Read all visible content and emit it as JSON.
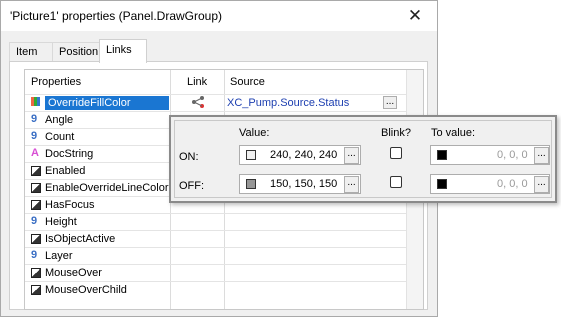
{
  "window": {
    "title": "'Picture1' properties (Panel.DrawGroup)",
    "close_glyph": "✕"
  },
  "tabs": [
    {
      "label": "Item"
    },
    {
      "label": "Position"
    },
    {
      "label": "Links"
    }
  ],
  "grid": {
    "headers": {
      "properties": "Properties",
      "link": "Link",
      "source": "Source"
    },
    "rows": [
      {
        "name": "OverrideFillColor",
        "type": "color",
        "icon": "color-type-icon",
        "linked": true,
        "source": "XC_Pump.Source.Status",
        "selected": true
      },
      {
        "name": "Angle",
        "type": "num",
        "icon_glyph": "9"
      },
      {
        "name": "Count",
        "type": "num",
        "icon_glyph": "9"
      },
      {
        "name": "DocString",
        "type": "str",
        "icon_glyph": "A"
      },
      {
        "name": "Enabled",
        "type": "bool"
      },
      {
        "name": "EnableOverrideLineColor",
        "type": "bool"
      },
      {
        "name": "HasFocus",
        "type": "bool"
      },
      {
        "name": "Height",
        "type": "num",
        "icon_glyph": "9"
      },
      {
        "name": "IsObjectActive",
        "type": "bool"
      },
      {
        "name": "Layer",
        "type": "num",
        "icon_glyph": "9"
      },
      {
        "name": "MouseOver",
        "type": "bool"
      },
      {
        "name": "MouseOverChild",
        "type": "bool"
      }
    ],
    "ellipsis": "..."
  },
  "popup": {
    "headers": {
      "value": "Value:",
      "blink": "Blink?",
      "to_value": "To value:"
    },
    "on": {
      "label": "ON:",
      "value": "240, 240, 240",
      "value_color": "#f0f0f0",
      "blink": false,
      "to_value": "0, 0, 0",
      "to_color": "#000000"
    },
    "off": {
      "label": "OFF:",
      "value": "150, 150, 150",
      "value_color": "#969696",
      "blink": false,
      "to_value": "0, 0, 0",
      "to_color": "#000000"
    },
    "ellipsis": "..."
  },
  "colors": {
    "selection": "#1a76d2",
    "source_text": "#1d3fb0",
    "number_type": "#3b6fc4",
    "string_type": "#d84fd4"
  }
}
